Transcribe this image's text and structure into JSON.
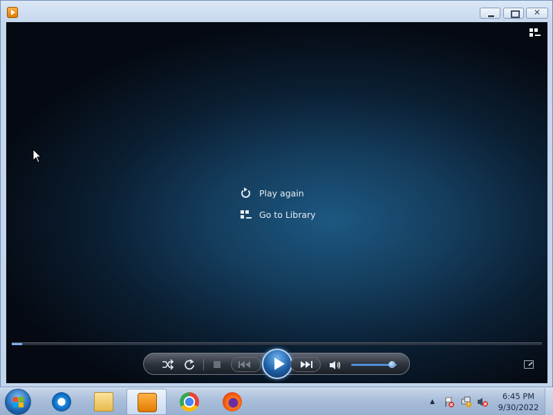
{
  "window": {
    "title": ""
  },
  "player": {
    "overlay": {
      "play_again": "Play again",
      "go_to_library": "Go to Library"
    },
    "seek_progress": 0.02,
    "volume_level": 0.9
  },
  "taskbar": {
    "items": [
      {
        "name": "Internet Explorer",
        "icon": "ie-icon"
      },
      {
        "name": "Windows Explorer",
        "icon": "folder-icon"
      },
      {
        "name": "Windows Media Player",
        "icon": "media-player-icon",
        "active": true
      },
      {
        "name": "Google Chrome",
        "icon": "chrome-icon"
      },
      {
        "name": "Firefox",
        "icon": "firefox-icon"
      }
    ],
    "clock": {
      "time": "6:45 PM",
      "date": "9/30/2022"
    }
  },
  "colors": {
    "accent": "#1e5fa6",
    "player_bg": "#143c5c"
  }
}
